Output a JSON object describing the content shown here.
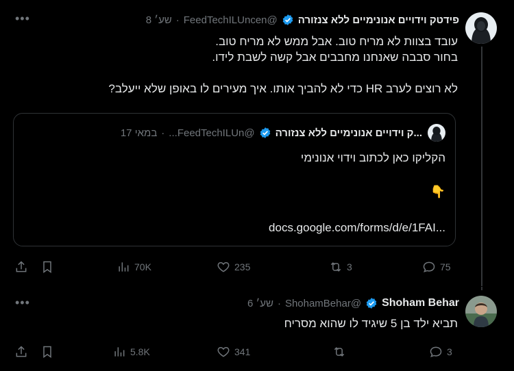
{
  "post": {
    "author_name": "פידטק וידויים אנונימיים ללא צנזורה",
    "handle": "@FeedTechILUncen",
    "time": "שע׳ 8",
    "separator": "·",
    "lines": [
      "עובד בצוות לא מריח טוב. אבל ממש לא מריח טוב.",
      "בחור סבבה שאנחנו מחבבים אבל קשה לשבת לידו.",
      "",
      "לא רוצים לערב HR כדי לא להביך אותו. איך מעירים לו באופן שלא ייעלב?"
    ],
    "quote": {
      "author_name": "...ק וידויים אנונימיים ללא צנזורה",
      "handle": "@FeedTechILUn...",
      "time": "במאי 17",
      "separator": "·",
      "text": "הקליקו כאן לכתוב וידוי אנונימי",
      "emoji": "👇",
      "link": "docs.google.com/forms/d/e/1FAI..."
    },
    "stats": {
      "replies": "75",
      "retweets": "3",
      "likes": "235",
      "views": "70K"
    }
  },
  "reply": {
    "author_name": "Shoham Behar",
    "handle": "@ShohamBehar",
    "time": "שע׳ 6",
    "separator": "·",
    "text": "תביא ילד בן 5 שיגיד לו שהוא מסריח",
    "stats": {
      "replies": "3",
      "retweets": "",
      "likes": "341",
      "views": "5.8K"
    }
  },
  "colors": {
    "background": "#000000",
    "text": "#e7e9ea",
    "muted": "#71767b",
    "verified": "#1d9bf0",
    "border": "#2f3336"
  },
  "icons": [
    "more-icon",
    "verified-icon",
    "reply-icon",
    "retweet-icon",
    "like-icon",
    "views-icon",
    "bookmark-icon",
    "share-icon"
  ]
}
